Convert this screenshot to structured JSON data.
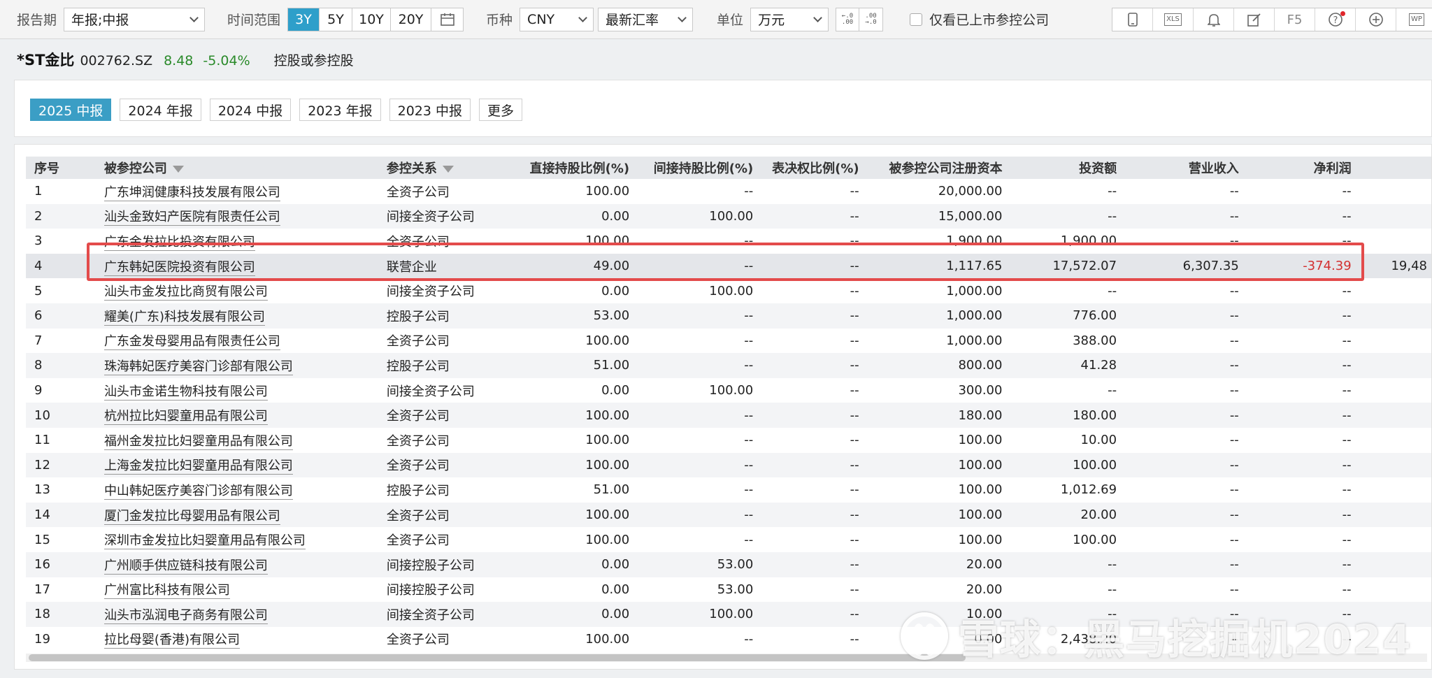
{
  "toolbar": {
    "report_period_label": "报告期",
    "report_period_value": "年报;中报",
    "time_range_label": "时间范围",
    "time_ranges": [
      "3Y",
      "5Y",
      "10Y",
      "20Y"
    ],
    "active_time_range": "3Y",
    "calendar_icon": "calendar-icon",
    "currency_label": "币种",
    "currency_value": "CNY",
    "rate_value": "最新汇率",
    "unit_label": "单位",
    "unit_value": "万元",
    "decimal_increase": "←.0 .00",
    "decimal_decrease": ".00 →.0",
    "listed_only_label": "仅看已上市参控公司",
    "icons": [
      "tablet-icon",
      "xls-export-icon",
      "bell-icon",
      "edit-icon",
      "f5-refresh-button",
      "help-icon",
      "add-icon",
      "wp-icon"
    ],
    "xls_text": "XLS",
    "f5_text": "F5",
    "wp_text": "WP"
  },
  "stock": {
    "name": "*ST金比",
    "code": "002762.SZ",
    "price": "8.48",
    "change": "-5.04%",
    "tab": "控股或参控股"
  },
  "periods": [
    "2025 中报",
    "2024 年报",
    "2024 中报",
    "2023 年报",
    "2023 中报",
    "更多"
  ],
  "active_period": "2025 中报",
  "table": {
    "headers": [
      "序号",
      "被参控公司",
      "参控关系",
      "直接持股比例(%)",
      "间接持股比例(%)",
      "表决权比例(%)",
      "被参控公司注册资本",
      "投资额",
      "营业收入",
      "净利润"
    ],
    "highlight_row": 4,
    "rows": [
      [
        "1",
        "广东坤润健康科技发展有限公司",
        "全资子公司",
        "100.00",
        "--",
        "--",
        "20,000.00",
        "--",
        "--",
        "--",
        ""
      ],
      [
        "2",
        "汕头金致妇产医院有限责任公司",
        "间接全资子公司",
        "0.00",
        "100.00",
        "--",
        "15,000.00",
        "--",
        "--",
        "--",
        ""
      ],
      [
        "3",
        "广东金发拉比投资有限公司",
        "全资子公司",
        "100.00",
        "--",
        "--",
        "1,900.00",
        "1,900.00",
        "--",
        "--",
        ""
      ],
      [
        "4",
        "广东韩妃医院投资有限公司",
        "联营企业",
        "49.00",
        "--",
        "--",
        "1,117.65",
        "17,572.07",
        "6,307.35",
        "-374.39",
        "19,48"
      ],
      [
        "5",
        "汕头市金发拉比商贸有限公司",
        "间接全资子公司",
        "0.00",
        "100.00",
        "--",
        "1,000.00",
        "--",
        "--",
        "--",
        ""
      ],
      [
        "6",
        "耀美(广东)科技发展有限公司",
        "控股子公司",
        "53.00",
        "--",
        "--",
        "1,000.00",
        "776.00",
        "--",
        "--",
        ""
      ],
      [
        "7",
        "广东金发母婴用品有限责任公司",
        "全资子公司",
        "100.00",
        "--",
        "--",
        "1,000.00",
        "388.00",
        "--",
        "--",
        ""
      ],
      [
        "8",
        "珠海韩妃医疗美容门诊部有限公司",
        "控股子公司",
        "51.00",
        "--",
        "--",
        "800.00",
        "41.28",
        "--",
        "--",
        ""
      ],
      [
        "9",
        "汕头市金诺生物科技有限公司",
        "间接全资子公司",
        "0.00",
        "100.00",
        "--",
        "300.00",
        "--",
        "--",
        "--",
        ""
      ],
      [
        "10",
        "杭州拉比妇婴童用品有限公司",
        "全资子公司",
        "100.00",
        "--",
        "--",
        "180.00",
        "180.00",
        "--",
        "--",
        ""
      ],
      [
        "11",
        "福州金发拉比妇婴童用品有限公司",
        "全资子公司",
        "100.00",
        "--",
        "--",
        "100.00",
        "10.00",
        "--",
        "--",
        ""
      ],
      [
        "12",
        "上海金发拉比妇婴童用品有限公司",
        "全资子公司",
        "100.00",
        "--",
        "--",
        "100.00",
        "100.00",
        "--",
        "--",
        ""
      ],
      [
        "13",
        "中山韩妃医疗美容门诊部有限公司",
        "控股子公司",
        "51.00",
        "--",
        "--",
        "100.00",
        "1,012.69",
        "--",
        "--",
        ""
      ],
      [
        "14",
        "厦门金发拉比母婴用品有限公司",
        "全资子公司",
        "100.00",
        "--",
        "--",
        "100.00",
        "20.00",
        "--",
        "--",
        ""
      ],
      [
        "15",
        "深圳市金发拉比妇婴童用品有限公司",
        "全资子公司",
        "100.00",
        "--",
        "--",
        "100.00",
        "100.00",
        "--",
        "--",
        ""
      ],
      [
        "16",
        "广州顺手供应链科技有限公司",
        "间接控股子公司",
        "0.00",
        "53.00",
        "--",
        "20.00",
        "--",
        "--",
        "--",
        ""
      ],
      [
        "17",
        "广州富比科技有限公司",
        "间接控股子公司",
        "0.00",
        "53.00",
        "--",
        "20.00",
        "--",
        "--",
        "--",
        ""
      ],
      [
        "18",
        "汕头市泓润电子商务有限公司",
        "间接全资子公司",
        "0.00",
        "100.00",
        "--",
        "10.00",
        "--",
        "--",
        "--",
        ""
      ],
      [
        "19",
        "拉比母婴(香港)有限公司",
        "全资子公司",
        "100.00",
        "--",
        "--",
        "0.00",
        "2,438.20",
        "--",
        "--",
        ""
      ]
    ]
  },
  "watermark": "雪球：黑马挖掘机2024",
  "colors": {
    "accent": "#2e9fca",
    "negative": "#d32f2f",
    "positive": "#2a8a2a",
    "highlight_border": "#e34b4b"
  }
}
